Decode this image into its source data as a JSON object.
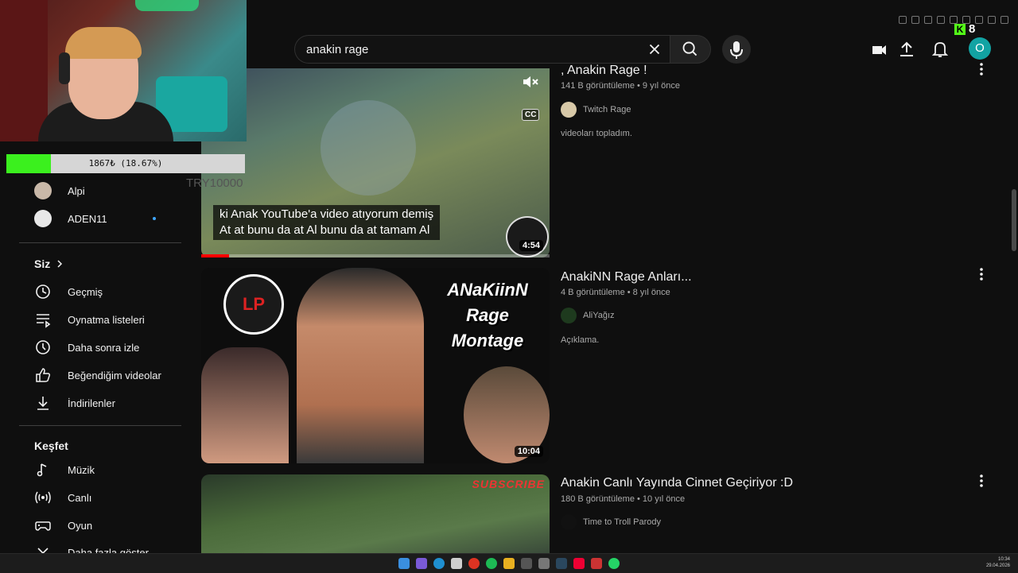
{
  "browser": {
    "kick_letter": "K",
    "kick_count": "8"
  },
  "header": {
    "search_query": "anakin rage",
    "avatar_letter": "O",
    "icons": [
      "create-icon",
      "upload-icon",
      "notifications-icon"
    ]
  },
  "stream_overlay": {
    "goal_text": "1867₺ (18.67%)",
    "goal_progress": 0.1867,
    "goal_color": "#3bf01e",
    "ghost_text": "TRY10000"
  },
  "sidebar": {
    "subscriptions": [
      {
        "name": "Alpi",
        "live": false
      },
      {
        "name": "ADEN11",
        "live": true
      }
    ],
    "you_section": {
      "title": "Siz",
      "items": [
        {
          "label": "Geçmiş",
          "icon": "history-icon"
        },
        {
          "label": "Oynatma listeleri",
          "icon": "playlists-icon"
        },
        {
          "label": "Daha sonra izle",
          "icon": "watch-later-icon"
        },
        {
          "label": "Beğendiğim videolar",
          "icon": "liked-icon"
        },
        {
          "label": "İndirilenler",
          "icon": "downloads-icon"
        }
      ]
    },
    "explore_section": {
      "title": "Keşfet",
      "items": [
        {
          "label": "Müzik",
          "icon": "music-icon"
        },
        {
          "label": "Canlı",
          "icon": "live-icon"
        },
        {
          "label": "Oyun",
          "icon": "gaming-icon"
        },
        {
          "label": "Daha fazla göster",
          "icon": "chevron-down-icon"
        }
      ]
    }
  },
  "results": [
    {
      "title": ", Anakin Rage !",
      "meta": "141 B görüntüleme • 9 yıl önce",
      "channel": "Twitch Rage",
      "description": "videoları topladım.",
      "duration": "4:54",
      "caption_lines": [
        "ki Anak YouTube'a video atıyorum demiş",
        "At at bunu da at Al bunu da at tamam Al"
      ],
      "cc_label": "CC",
      "watched_progress": 0.08
    },
    {
      "title": "AnakiNN Rage Anları...",
      "meta": "4 B görüntüleme • 8 yıl önce",
      "channel": "AliYağız",
      "description": "Açıklama.",
      "duration": "10:04",
      "thumb_text": [
        "ANaKiinN",
        "Rage",
        "Montage"
      ],
      "thumb_logo": "LP"
    },
    {
      "title": "Anakin Canlı Yayında Cinnet Geçiriyor :D",
      "meta": "180 B görüntüleme • 10 yıl önce",
      "channel": "Time to Troll Parody",
      "thumb_text": "SUBSCRIBE"
    }
  ],
  "taskbar": {
    "time": "10:34",
    "date": "29.04.2026"
  }
}
